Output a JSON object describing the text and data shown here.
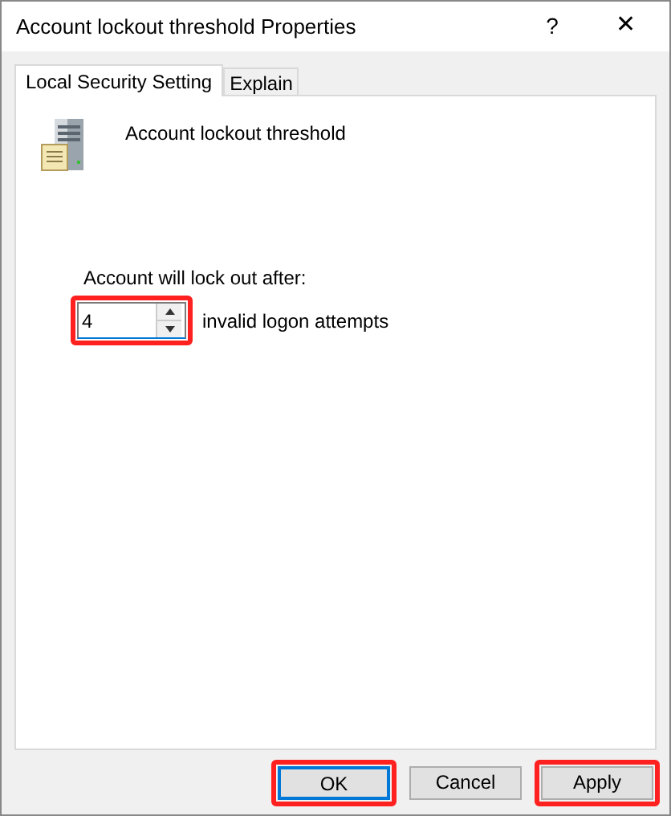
{
  "window": {
    "title": "Account lockout threshold Properties",
    "help": "?",
    "close": "✕"
  },
  "tabs": [
    {
      "label": "Local Security Setting",
      "selected": true
    },
    {
      "label": "Explain",
      "selected": false
    }
  ],
  "policy": {
    "name": "Account lockout threshold"
  },
  "lockout": {
    "label": "Account will lock out after:",
    "value": "4",
    "highlighted": true,
    "suffix": "invalid logon attempts"
  },
  "buttons": [
    {
      "label": "OK",
      "default": true,
      "highlighted": true
    },
    {
      "label": "Cancel",
      "default": false,
      "highlighted": false
    },
    {
      "label": "Apply",
      "default": false,
      "highlighted": true
    }
  ]
}
